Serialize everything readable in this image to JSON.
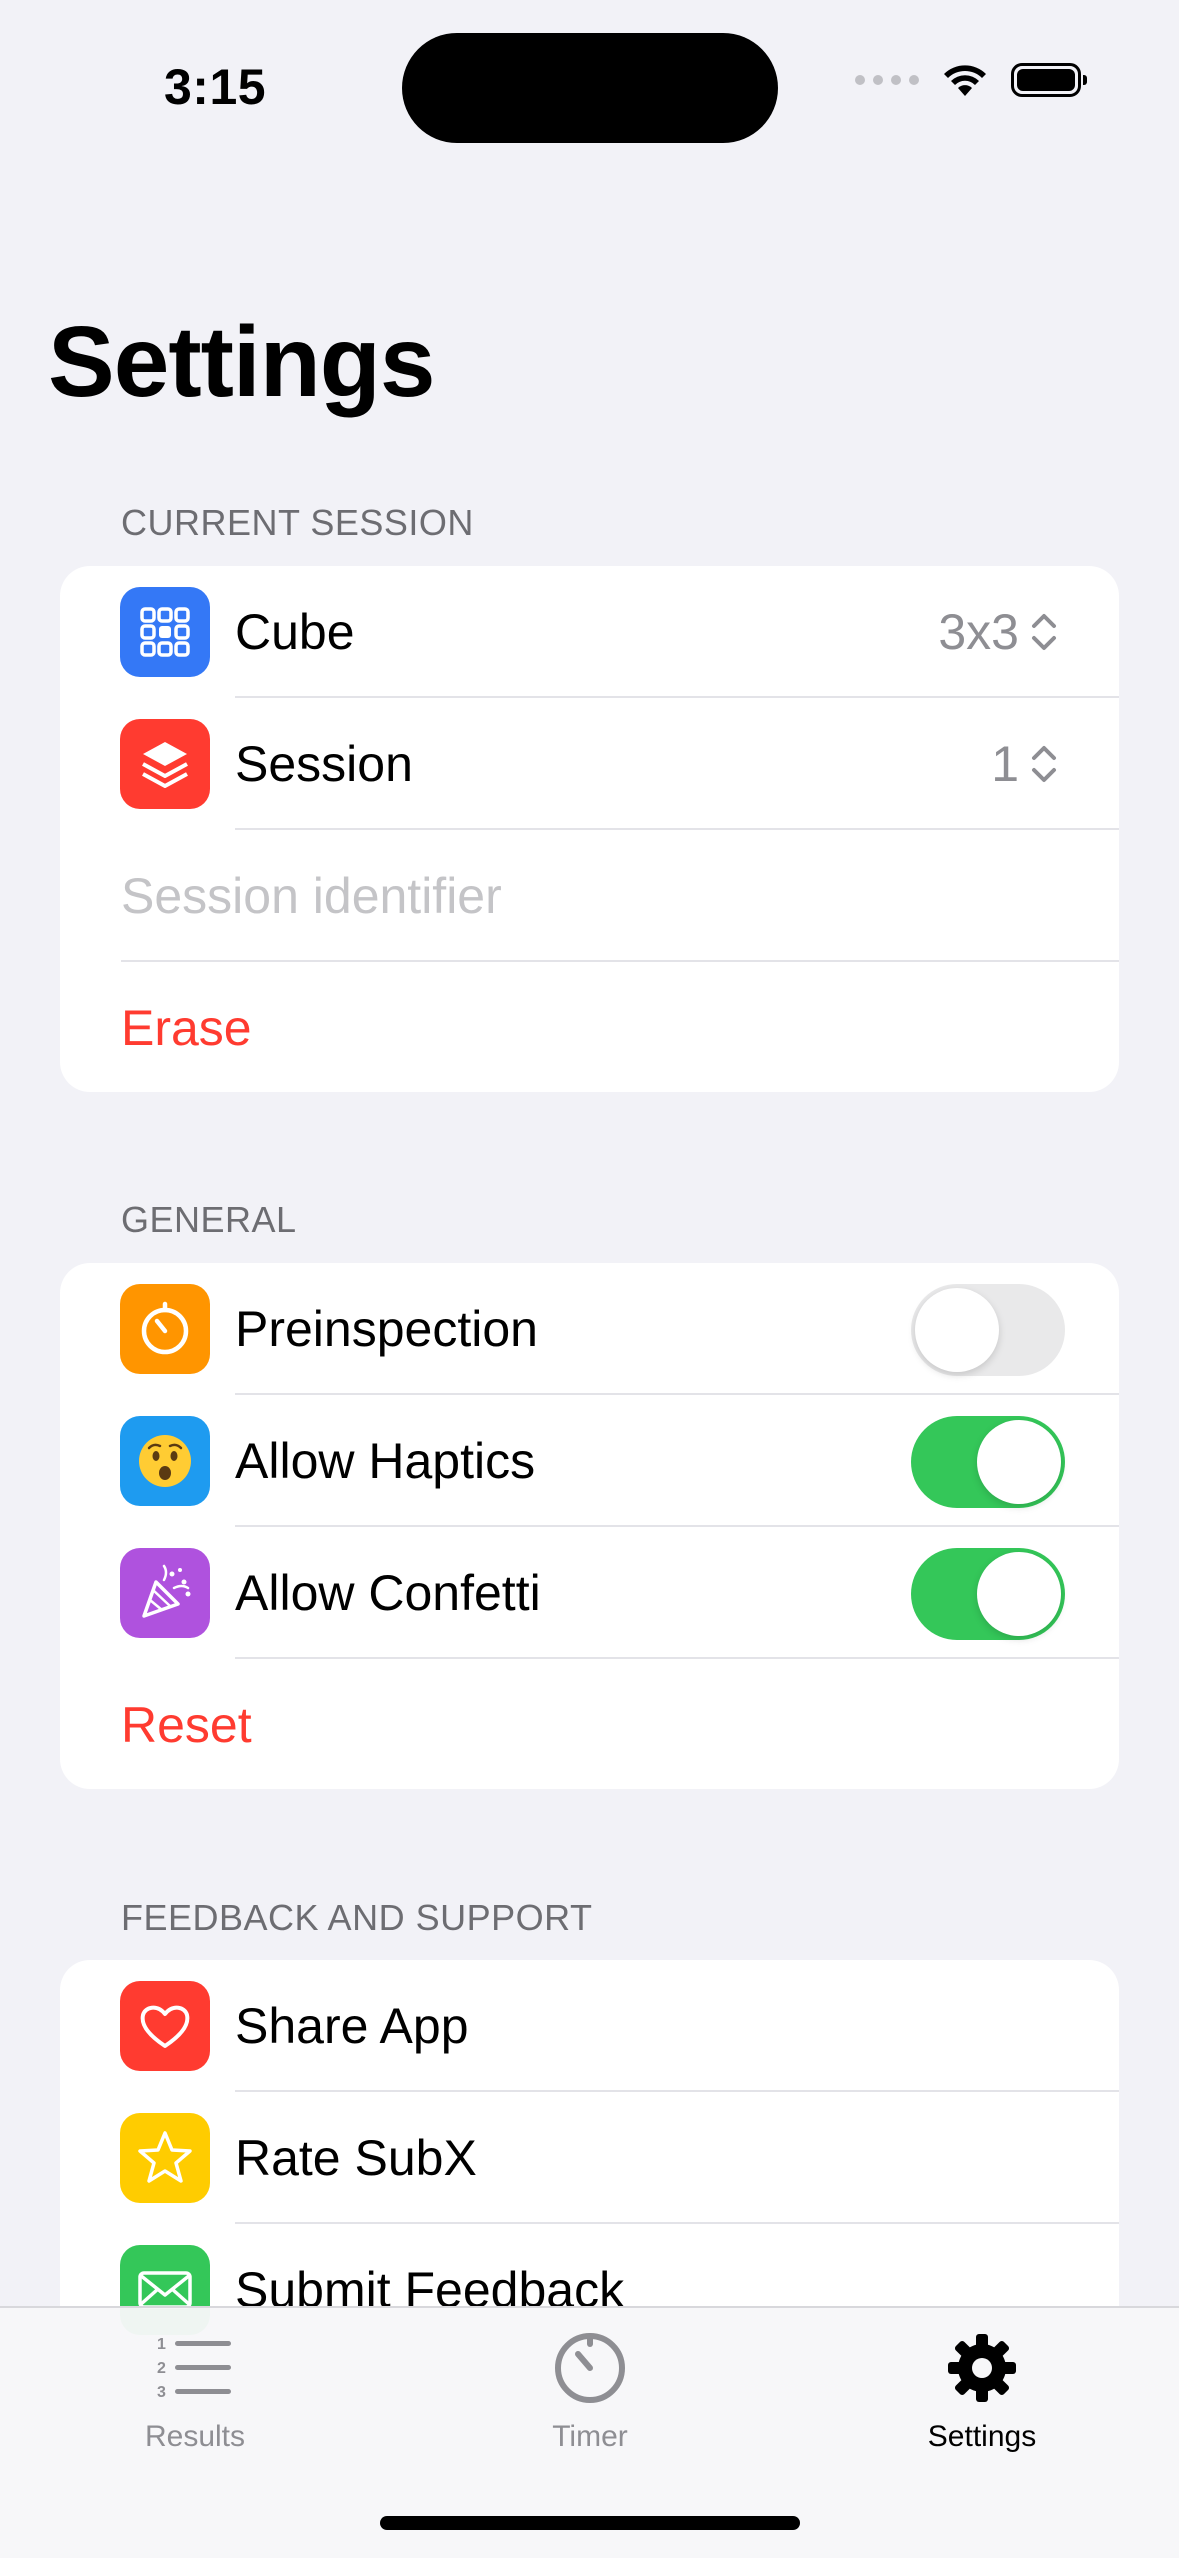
{
  "status_bar": {
    "time": "3:15"
  },
  "page": {
    "title": "Settings"
  },
  "sections": {
    "current_session": {
      "header": "CURRENT SESSION",
      "cube_label": "Cube",
      "cube_value": "3x3",
      "session_label": "Session",
      "session_value": "1",
      "identifier_placeholder": "Session identifier",
      "erase_label": "Erase"
    },
    "general": {
      "header": "GENERAL",
      "preinspection_label": "Preinspection",
      "preinspection_on": false,
      "haptics_label": "Allow Haptics",
      "haptics_on": true,
      "confetti_label": "Allow Confetti",
      "confetti_on": true,
      "reset_label": "Reset"
    },
    "feedback": {
      "header": "FEEDBACK AND SUPPORT",
      "share_label": "Share App",
      "rate_label": "Rate SubX",
      "submit_label": "Submit Feedback"
    }
  },
  "tabbar": {
    "results": "Results",
    "timer": "Timer",
    "settings": "Settings",
    "active": "settings"
  },
  "colors": {
    "accent_red": "#ff3b30",
    "toggle_on": "#34c759",
    "cube_icon_bg": "#3478f6",
    "session_icon_bg": "#ff3b30",
    "preinspection_icon_bg": "#ff9500",
    "haptics_icon_bg": "#1e9bf0",
    "confetti_icon_bg": "#af52de",
    "share_icon_bg": "#ff3b30",
    "rate_icon_bg": "#ffcc00",
    "submit_icon_bg": "#34c759"
  },
  "icons": {
    "cube": "grid-icon",
    "session": "stack-icon",
    "preinspection": "timer-icon",
    "haptics": "surprised-face-icon",
    "confetti": "party-popper-icon",
    "share": "heart-icon",
    "rate": "star-icon",
    "submit": "envelope-icon"
  }
}
